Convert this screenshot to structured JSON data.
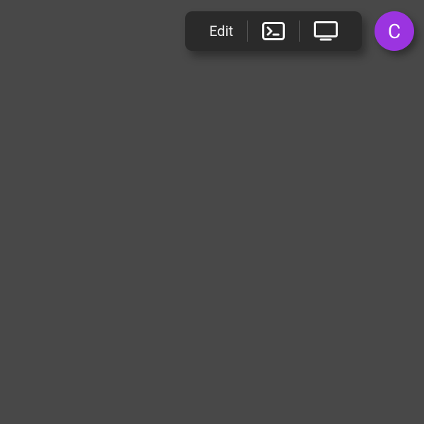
{
  "toolbar": {
    "edit_label": "Edit",
    "icons": {
      "terminal": "terminal-icon",
      "display": "display-icon"
    }
  },
  "avatar": {
    "initial": "C",
    "bg_color": "#9b34e0"
  }
}
